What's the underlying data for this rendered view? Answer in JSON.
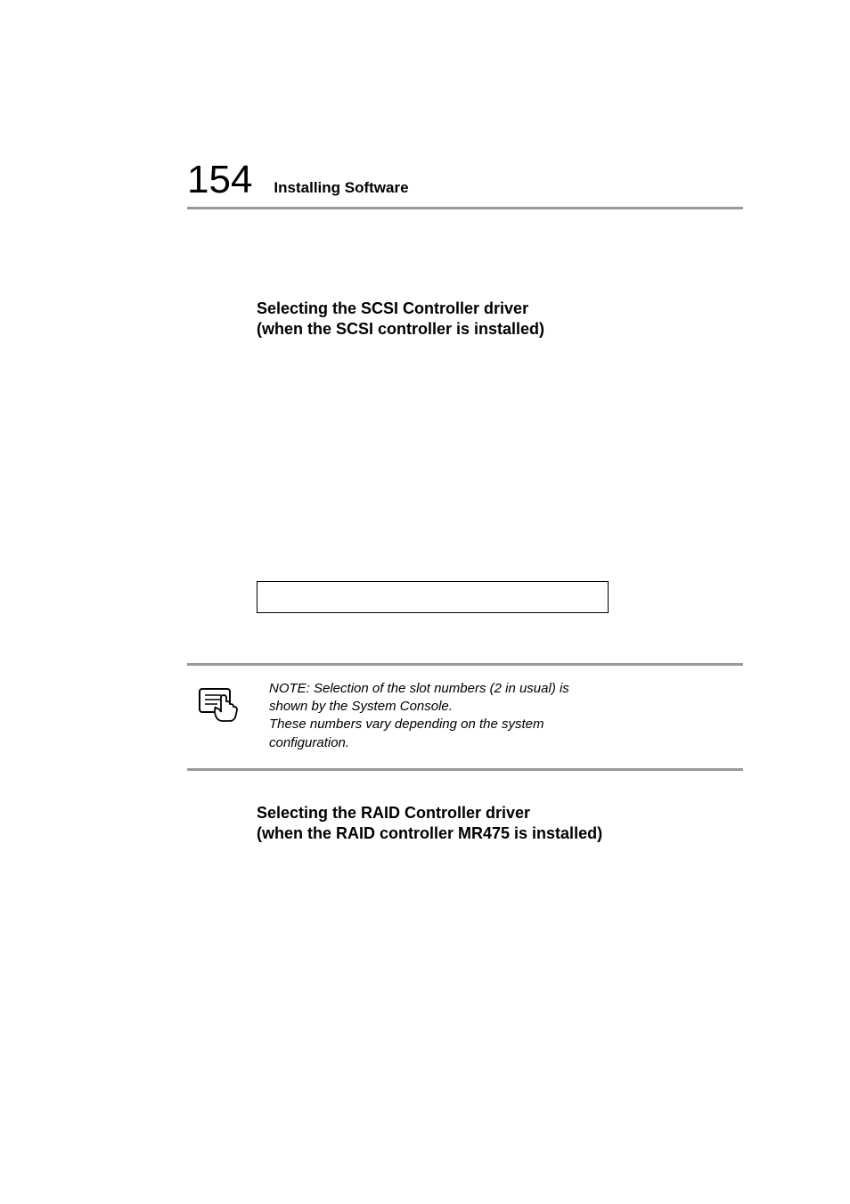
{
  "header": {
    "page_number": "154",
    "chapter_title": "Installing Software"
  },
  "sections": {
    "scsi": {
      "line1": "Selecting the SCSI Controller driver",
      "line2": "(when the SCSI controller is installed)"
    },
    "raid": {
      "line1": "Selecting the RAID Controller driver",
      "line2": "(when the RAID controller MR475 is installed)"
    }
  },
  "note": {
    "line1": "NOTE: Selection of the slot numbers (2 in usual) is shown by the System Console.",
    "line2": "These numbers vary depending on the system configuration."
  },
  "icons": {
    "note": "note-hand-icon"
  }
}
